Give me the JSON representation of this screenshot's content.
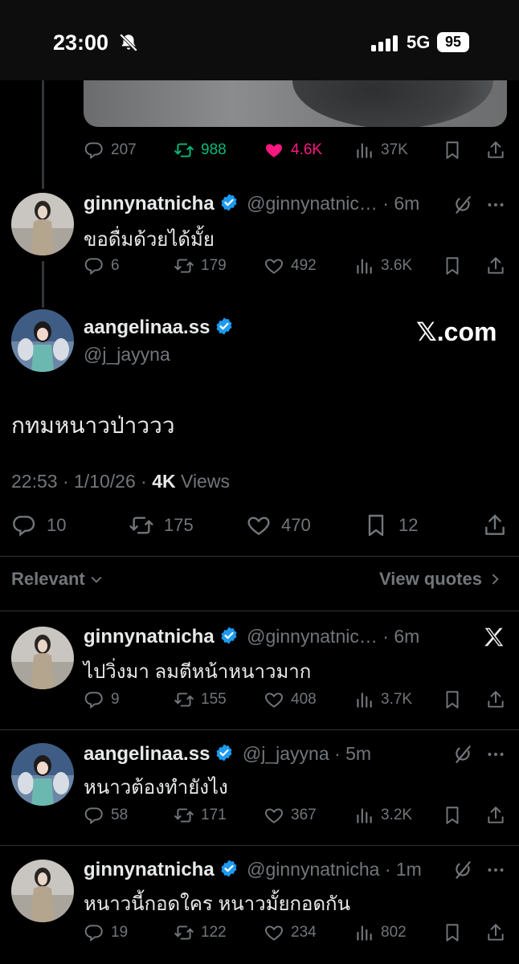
{
  "status_bar": {
    "time": "23:00",
    "network": "5G",
    "battery": "95"
  },
  "top_actions": {
    "replies": "207",
    "reposts": "988",
    "likes": "4.6K",
    "views": "37K"
  },
  "reply1": {
    "name": "ginnynatnicha",
    "handle": "@ginnynatnic…",
    "time": "6m",
    "text": "ขอดื่มด้วยได้มั้ย",
    "replies": "6",
    "reposts": "179",
    "likes": "492",
    "views": "3.6K"
  },
  "main_post": {
    "name": "aangelinaa.ss",
    "handle": "@j_jayyna",
    "source": "𝕏.com",
    "text": "กทมหนาวป่าววว",
    "time": "22:53",
    "sep1": " · ",
    "date": "1/10/26",
    "sep2": " · ",
    "views_count": "4K",
    "views_label": " Views",
    "replies": "10",
    "reposts": "175",
    "likes": "470",
    "bookmarks": "12"
  },
  "filter": {
    "relevant": "Relevant",
    "view_quotes": "View quotes"
  },
  "replies": [
    {
      "name": "ginnynatnicha",
      "handle": "@ginnynatnic…",
      "sep": " · ",
      "time": "6m",
      "text": "ไปวิ่งมา ลมตีหน้าหนาวมาก",
      "replies": "9",
      "reposts": "155",
      "likes": "408",
      "views": "3.7K"
    },
    {
      "name": "aangelinaa.ss",
      "handle": "@j_jayyna",
      "sep": " · ",
      "time": "5m",
      "text": "หนาวต้องทำยังไง",
      "replies": "58",
      "reposts": "171",
      "likes": "367",
      "views": "3.2K"
    },
    {
      "name": "ginnynatnicha",
      "handle": "@ginnynatnicha",
      "sep": " · ",
      "time": "1m",
      "text": "หนาวนี้กอดใคร หนาวมั้ยกอดกัน",
      "replies": "19",
      "reposts": "122",
      "likes": "234",
      "views": "802"
    }
  ],
  "colors": {
    "like_active": "#f91880",
    "repost_active": "#00ba7c",
    "verified": "#1d9bf0"
  },
  "icons": [
    "bell-slash-icon",
    "signal-icon",
    "reply-icon",
    "repost-icon",
    "heart-icon",
    "views-icon",
    "bookmark-icon",
    "share-icon",
    "verified-icon",
    "more-icon",
    "grok-icon",
    "x-logo-icon",
    "chevron-down-icon",
    "chevron-right-icon"
  ]
}
